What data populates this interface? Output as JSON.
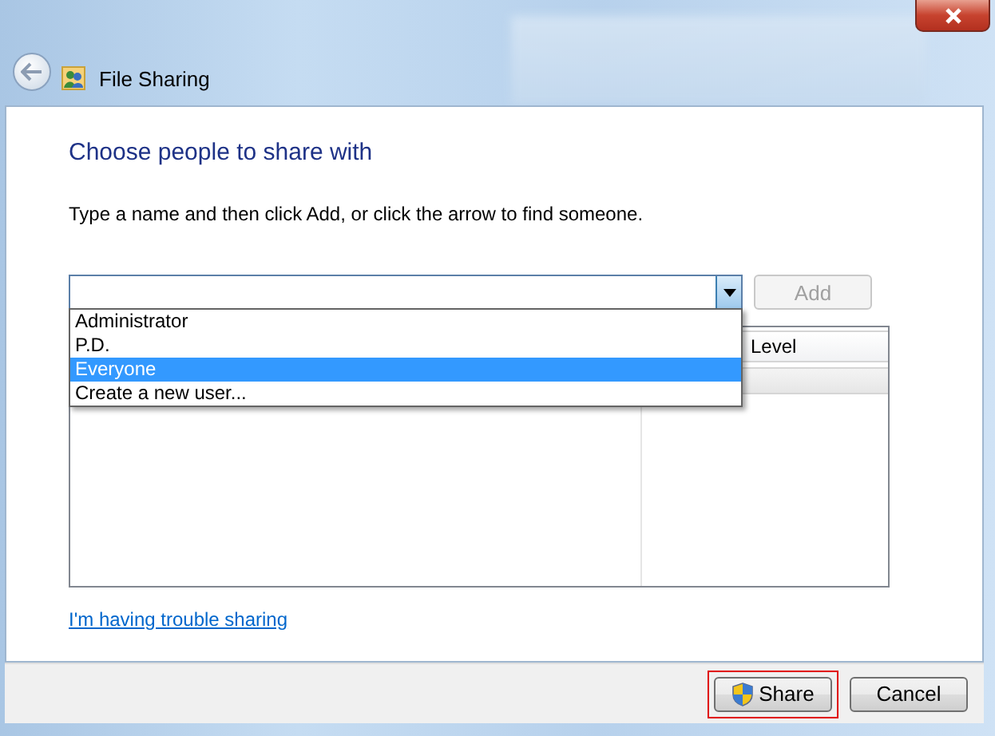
{
  "window": {
    "title": "File Sharing"
  },
  "heading": "Choose people to share with",
  "instruction": "Type a name and then click Add, or click the arrow to find someone.",
  "name_combo": {
    "expanded": true,
    "options": [
      {
        "label": "Administrator",
        "selected": false
      },
      {
        "label": "P.D.",
        "selected": false
      },
      {
        "label": "Everyone",
        "selected": true
      },
      {
        "label": "Create a new user...",
        "selected": false
      }
    ]
  },
  "add_button": {
    "label": "Add",
    "disabled": true
  },
  "table": {
    "column_2": "Level"
  },
  "help_link": "I'm having trouble sharing",
  "buttons": [
    {
      "label": "Share",
      "kind": "shield",
      "highlighted": true
    },
    {
      "label": "Cancel",
      "kind": "plain",
      "highlighted": false
    }
  ]
}
